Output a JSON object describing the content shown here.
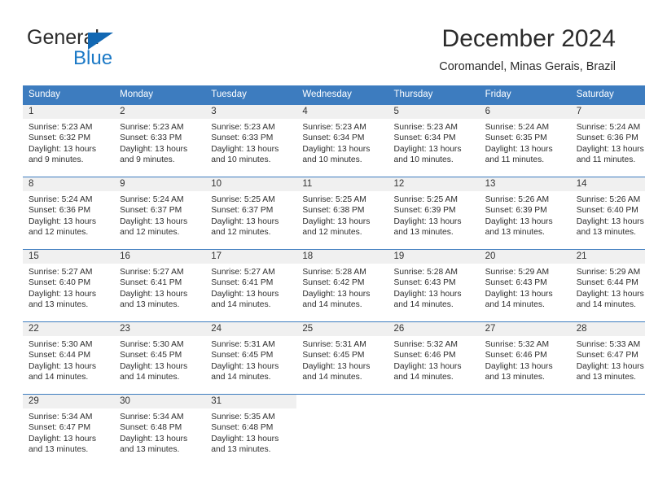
{
  "logo": {
    "word_top": "General",
    "word_bottom": "Blue",
    "triangle_color": "#1268b3",
    "blue_text_color": "#1b79c6"
  },
  "header": {
    "title": "December 2024",
    "subtitle": "Coromandel, Minas Gerais, Brazil"
  },
  "theme": {
    "header_blue": "#3d7cbf",
    "daynum_band": "#f0f0f0",
    "text": "#333333"
  },
  "weekdays": [
    "Sunday",
    "Monday",
    "Tuesday",
    "Wednesday",
    "Thursday",
    "Friday",
    "Saturday"
  ],
  "weeks": [
    [
      {
        "day": "1",
        "sunrise": "Sunrise: 5:23 AM",
        "sunset": "Sunset: 6:32 PM",
        "daylight1": "Daylight: 13 hours",
        "daylight2": "and 9 minutes."
      },
      {
        "day": "2",
        "sunrise": "Sunrise: 5:23 AM",
        "sunset": "Sunset: 6:33 PM",
        "daylight1": "Daylight: 13 hours",
        "daylight2": "and 9 minutes."
      },
      {
        "day": "3",
        "sunrise": "Sunrise: 5:23 AM",
        "sunset": "Sunset: 6:33 PM",
        "daylight1": "Daylight: 13 hours",
        "daylight2": "and 10 minutes."
      },
      {
        "day": "4",
        "sunrise": "Sunrise: 5:23 AM",
        "sunset": "Sunset: 6:34 PM",
        "daylight1": "Daylight: 13 hours",
        "daylight2": "and 10 minutes."
      },
      {
        "day": "5",
        "sunrise": "Sunrise: 5:23 AM",
        "sunset": "Sunset: 6:34 PM",
        "daylight1": "Daylight: 13 hours",
        "daylight2": "and 10 minutes."
      },
      {
        "day": "6",
        "sunrise": "Sunrise: 5:24 AM",
        "sunset": "Sunset: 6:35 PM",
        "daylight1": "Daylight: 13 hours",
        "daylight2": "and 11 minutes."
      },
      {
        "day": "7",
        "sunrise": "Sunrise: 5:24 AM",
        "sunset": "Sunset: 6:36 PM",
        "daylight1": "Daylight: 13 hours",
        "daylight2": "and 11 minutes."
      }
    ],
    [
      {
        "day": "8",
        "sunrise": "Sunrise: 5:24 AM",
        "sunset": "Sunset: 6:36 PM",
        "daylight1": "Daylight: 13 hours",
        "daylight2": "and 12 minutes."
      },
      {
        "day": "9",
        "sunrise": "Sunrise: 5:24 AM",
        "sunset": "Sunset: 6:37 PM",
        "daylight1": "Daylight: 13 hours",
        "daylight2": "and 12 minutes."
      },
      {
        "day": "10",
        "sunrise": "Sunrise: 5:25 AM",
        "sunset": "Sunset: 6:37 PM",
        "daylight1": "Daylight: 13 hours",
        "daylight2": "and 12 minutes."
      },
      {
        "day": "11",
        "sunrise": "Sunrise: 5:25 AM",
        "sunset": "Sunset: 6:38 PM",
        "daylight1": "Daylight: 13 hours",
        "daylight2": "and 12 minutes."
      },
      {
        "day": "12",
        "sunrise": "Sunrise: 5:25 AM",
        "sunset": "Sunset: 6:39 PM",
        "daylight1": "Daylight: 13 hours",
        "daylight2": "and 13 minutes."
      },
      {
        "day": "13",
        "sunrise": "Sunrise: 5:26 AM",
        "sunset": "Sunset: 6:39 PM",
        "daylight1": "Daylight: 13 hours",
        "daylight2": "and 13 minutes."
      },
      {
        "day": "14",
        "sunrise": "Sunrise: 5:26 AM",
        "sunset": "Sunset: 6:40 PM",
        "daylight1": "Daylight: 13 hours",
        "daylight2": "and 13 minutes."
      }
    ],
    [
      {
        "day": "15",
        "sunrise": "Sunrise: 5:27 AM",
        "sunset": "Sunset: 6:40 PM",
        "daylight1": "Daylight: 13 hours",
        "daylight2": "and 13 minutes."
      },
      {
        "day": "16",
        "sunrise": "Sunrise: 5:27 AM",
        "sunset": "Sunset: 6:41 PM",
        "daylight1": "Daylight: 13 hours",
        "daylight2": "and 13 minutes."
      },
      {
        "day": "17",
        "sunrise": "Sunrise: 5:27 AM",
        "sunset": "Sunset: 6:41 PM",
        "daylight1": "Daylight: 13 hours",
        "daylight2": "and 14 minutes."
      },
      {
        "day": "18",
        "sunrise": "Sunrise: 5:28 AM",
        "sunset": "Sunset: 6:42 PM",
        "daylight1": "Daylight: 13 hours",
        "daylight2": "and 14 minutes."
      },
      {
        "day": "19",
        "sunrise": "Sunrise: 5:28 AM",
        "sunset": "Sunset: 6:43 PM",
        "daylight1": "Daylight: 13 hours",
        "daylight2": "and 14 minutes."
      },
      {
        "day": "20",
        "sunrise": "Sunrise: 5:29 AM",
        "sunset": "Sunset: 6:43 PM",
        "daylight1": "Daylight: 13 hours",
        "daylight2": "and 14 minutes."
      },
      {
        "day": "21",
        "sunrise": "Sunrise: 5:29 AM",
        "sunset": "Sunset: 6:44 PM",
        "daylight1": "Daylight: 13 hours",
        "daylight2": "and 14 minutes."
      }
    ],
    [
      {
        "day": "22",
        "sunrise": "Sunrise: 5:30 AM",
        "sunset": "Sunset: 6:44 PM",
        "daylight1": "Daylight: 13 hours",
        "daylight2": "and 14 minutes."
      },
      {
        "day": "23",
        "sunrise": "Sunrise: 5:30 AM",
        "sunset": "Sunset: 6:45 PM",
        "daylight1": "Daylight: 13 hours",
        "daylight2": "and 14 minutes."
      },
      {
        "day": "24",
        "sunrise": "Sunrise: 5:31 AM",
        "sunset": "Sunset: 6:45 PM",
        "daylight1": "Daylight: 13 hours",
        "daylight2": "and 14 minutes."
      },
      {
        "day": "25",
        "sunrise": "Sunrise: 5:31 AM",
        "sunset": "Sunset: 6:45 PM",
        "daylight1": "Daylight: 13 hours",
        "daylight2": "and 14 minutes."
      },
      {
        "day": "26",
        "sunrise": "Sunrise: 5:32 AM",
        "sunset": "Sunset: 6:46 PM",
        "daylight1": "Daylight: 13 hours",
        "daylight2": "and 14 minutes."
      },
      {
        "day": "27",
        "sunrise": "Sunrise: 5:32 AM",
        "sunset": "Sunset: 6:46 PM",
        "daylight1": "Daylight: 13 hours",
        "daylight2": "and 13 minutes."
      },
      {
        "day": "28",
        "sunrise": "Sunrise: 5:33 AM",
        "sunset": "Sunset: 6:47 PM",
        "daylight1": "Daylight: 13 hours",
        "daylight2": "and 13 minutes."
      }
    ],
    [
      {
        "day": "29",
        "sunrise": "Sunrise: 5:34 AM",
        "sunset": "Sunset: 6:47 PM",
        "daylight1": "Daylight: 13 hours",
        "daylight2": "and 13 minutes."
      },
      {
        "day": "30",
        "sunrise": "Sunrise: 5:34 AM",
        "sunset": "Sunset: 6:48 PM",
        "daylight1": "Daylight: 13 hours",
        "daylight2": "and 13 minutes."
      },
      {
        "day": "31",
        "sunrise": "Sunrise: 5:35 AM",
        "sunset": "Sunset: 6:48 PM",
        "daylight1": "Daylight: 13 hours",
        "daylight2": "and 13 minutes."
      },
      {
        "day": "",
        "sunrise": "",
        "sunset": "",
        "daylight1": "",
        "daylight2": ""
      },
      {
        "day": "",
        "sunrise": "",
        "sunset": "",
        "daylight1": "",
        "daylight2": ""
      },
      {
        "day": "",
        "sunrise": "",
        "sunset": "",
        "daylight1": "",
        "daylight2": ""
      },
      {
        "day": "",
        "sunrise": "",
        "sunset": "",
        "daylight1": "",
        "daylight2": ""
      }
    ]
  ]
}
